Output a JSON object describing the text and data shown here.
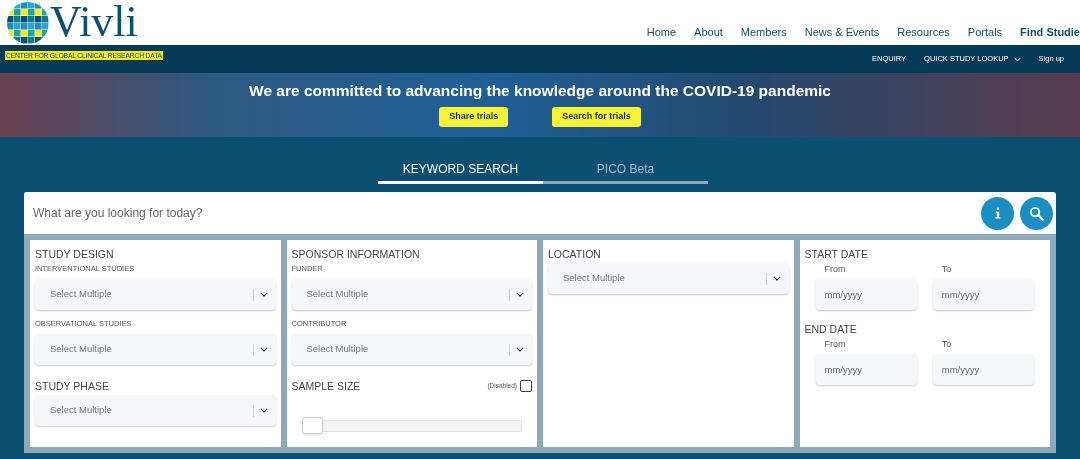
{
  "header": {
    "logo": {
      "name": "Vivli",
      "tagline": "CENTER FOR GLOBAL CLINICAL RESEARCH DATA"
    },
    "nav": [
      {
        "label": "Home",
        "selected": false
      },
      {
        "label": "About",
        "selected": false
      },
      {
        "label": "Members",
        "selected": false
      },
      {
        "label": "News & Events",
        "selected": false
      },
      {
        "label": "Resources",
        "selected": false
      },
      {
        "label": "Portals",
        "selected": false
      },
      {
        "label": "Find Studie",
        "selected": true
      }
    ],
    "subnav": [
      {
        "label": "ENQUIRY",
        "kind": "link"
      },
      {
        "label": "QUICK STUDY LOOKUP",
        "kind": "dropdown"
      },
      {
        "label": "Sign up",
        "kind": "link"
      }
    ]
  },
  "banner": {
    "headline": "We are committed to advancing the knowledge around the COVID-19 pandemic",
    "buttons": [
      "Share trials",
      "Search for trials"
    ]
  },
  "search_tabs": [
    {
      "label": "KEYWORD SEARCH",
      "selected": true
    },
    {
      "label": "PICO Beta",
      "selected": false
    }
  ],
  "search": {
    "placeholder": "What are you looking for today?"
  },
  "panels": [
    {
      "sections": [
        {
          "title": "STUDY DESIGN",
          "fields": [
            {
              "kind": "select",
              "label": "INTERVENTIONAL STUDIES",
              "placeholder": "Select Multiple"
            },
            {
              "kind": "select",
              "label": "OBSERVATIONAL STUDIES",
              "placeholder": "Select Multiple"
            }
          ]
        },
        {
          "title": "STUDY PHASE",
          "fields": [
            {
              "kind": "select",
              "placeholder": "Select Multiple"
            }
          ]
        }
      ]
    },
    {
      "sections": [
        {
          "title": "SPONSOR INFORMATION",
          "fields": [
            {
              "kind": "select",
              "label": "FUNDER",
              "placeholder": "Select Multiple"
            },
            {
              "kind": "select",
              "label": "CONTRIBUTOR",
              "placeholder": "Select Multiple"
            }
          ]
        },
        {
          "title": "SAMPLE SIZE",
          "toggle": {
            "label": "(Disabled)",
            "checked": false
          },
          "fields": [
            {
              "kind": "slider",
              "level": 0
            }
          ]
        }
      ]
    },
    {
      "sections": [
        {
          "title": "LOCATION",
          "fields": [
            {
              "kind": "select",
              "placeholder": "Select Multiple"
            }
          ]
        }
      ]
    },
    {
      "sections": [
        {
          "title": "START DATE",
          "fields": [
            {
              "kind": "date",
              "label": "From",
              "placeholder": "mm/yyyy"
            },
            {
              "kind": "date",
              "label": "To",
              "placeholder": "mm/yyyy"
            }
          ]
        },
        {
          "title": "END DATE",
          "fields": [
            {
              "kind": "date",
              "label": "From",
              "placeholder": "mm/yyyy"
            },
            {
              "kind": "date",
              "label": "To",
              "placeholder": "mm/yyyy"
            }
          ]
        }
      ]
    }
  ]
}
